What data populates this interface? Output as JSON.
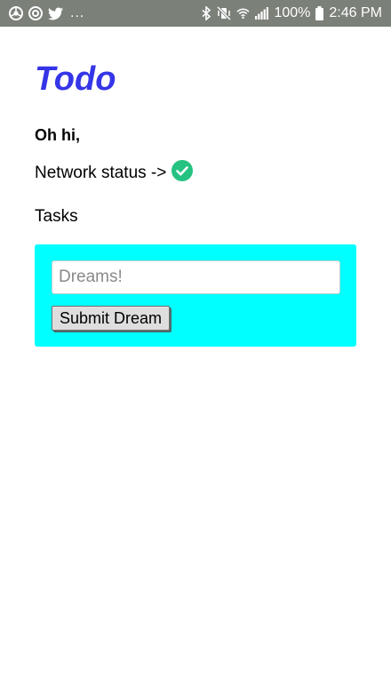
{
  "status_bar": {
    "left_icons": [
      "chrome-icon",
      "chrome-icon",
      "twitter-bird-icon"
    ],
    "overflow": "...",
    "battery": "100%",
    "time": "2:46 PM",
    "background": "#7b8079"
  },
  "app": {
    "title": "Todo",
    "title_color": "#3535e8",
    "greeting": "Oh hi,",
    "network_label": "Network status ->",
    "network_status_icon": "check-circle-icon",
    "network_status_color": "#26c281",
    "tasks_label": "Tasks"
  },
  "dream_form": {
    "panel_color": "#00ffff",
    "input_placeholder": "Dreams!",
    "input_value": "",
    "submit_label": "Submit Dream"
  }
}
